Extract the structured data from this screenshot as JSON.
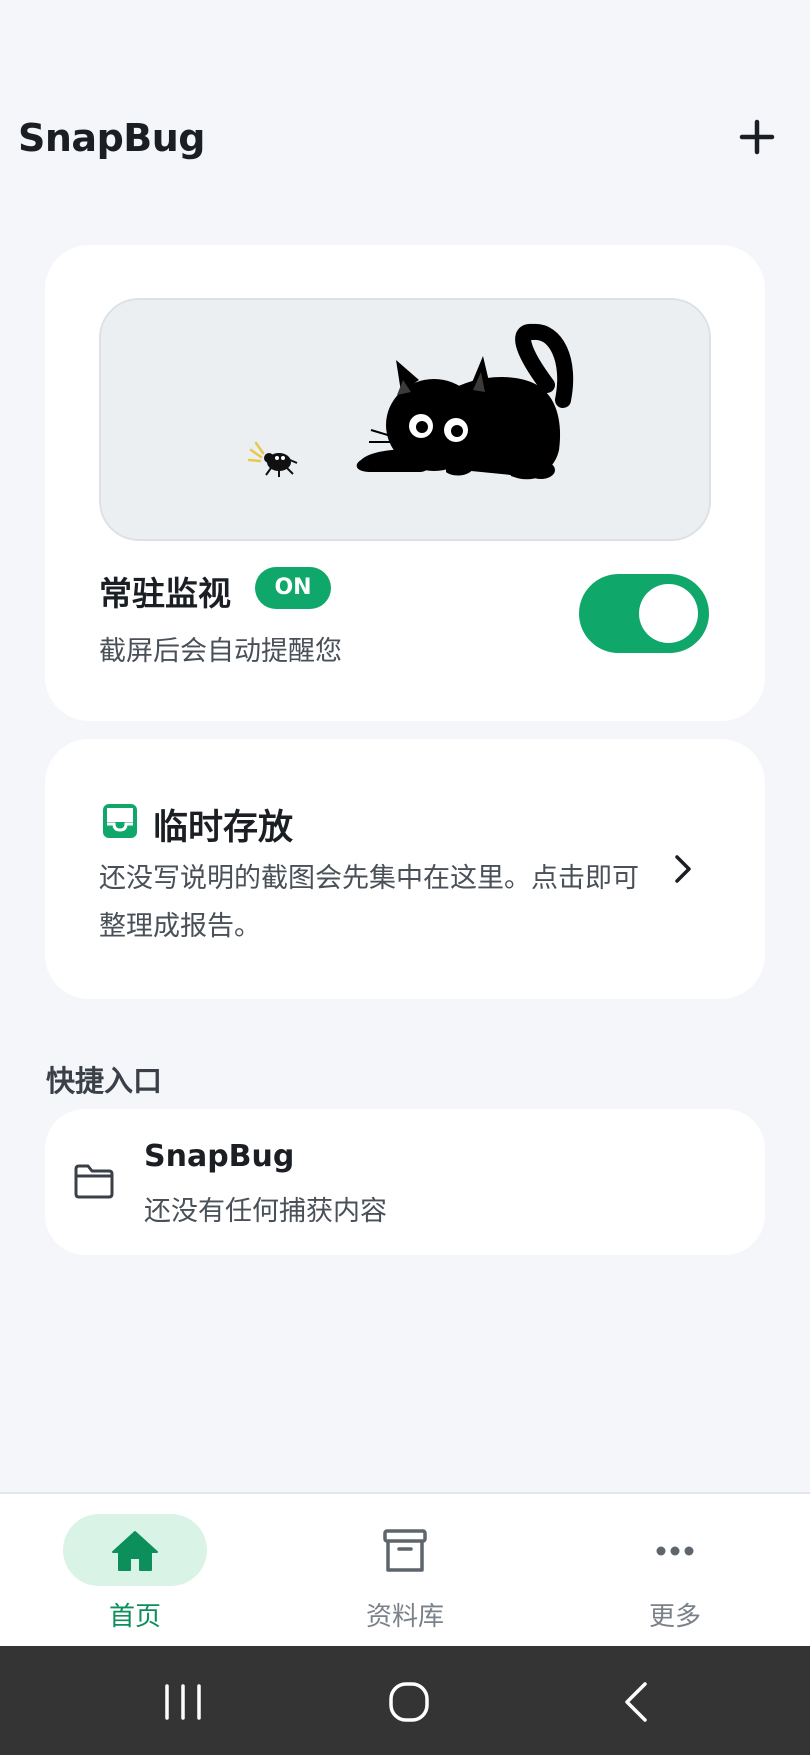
{
  "header": {
    "title": "SnapBug",
    "add_icon": "plus-icon"
  },
  "monitor_card": {
    "illustration": "black-cat-chasing-bug-illustration",
    "title": "常驻监视",
    "badge": "ON",
    "subtitle": "截屏后会自动提醒您",
    "toggle_on": true,
    "accent_color": "#0fa86a"
  },
  "temp_card": {
    "icon": "inbox-tray-icon",
    "title": "临时存放",
    "description": "还没写说明的截图会先集中在这里。点击即可整理成报告。",
    "chevron_icon": "chevron-right-icon"
  },
  "quick_section": {
    "label": "快捷入口",
    "items": [
      {
        "icon": "folder-icon",
        "title": "SnapBug",
        "subtitle": "还没有任何捕获内容"
      }
    ]
  },
  "bottom_nav": {
    "items": [
      {
        "label": "首页",
        "icon": "home-icon",
        "active": true
      },
      {
        "label": "资料库",
        "icon": "archive-box-icon",
        "active": false
      },
      {
        "label": "更多",
        "icon": "more-dots-icon",
        "active": false
      }
    ],
    "active_color": "#0c8f5a"
  },
  "system_nav": {
    "buttons": [
      "recents-icon",
      "home-circle-icon",
      "back-icon"
    ]
  }
}
